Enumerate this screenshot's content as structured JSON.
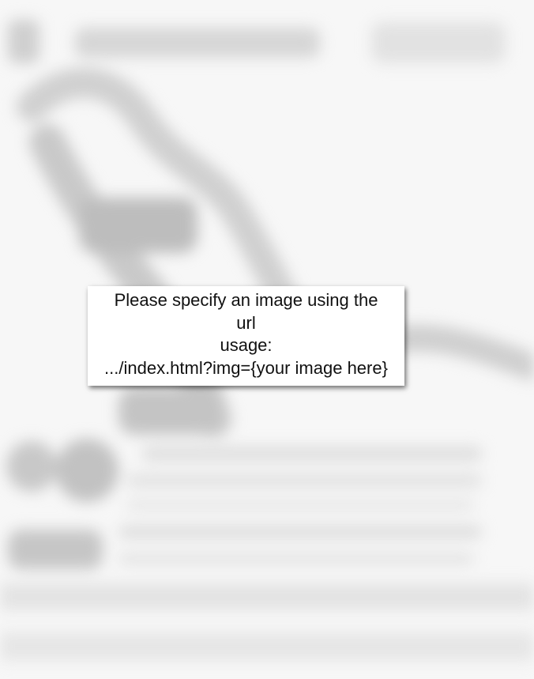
{
  "notice": {
    "line_1": "Please specify an image using the",
    "line_2": "url",
    "line_3": "usage:",
    "line_4": ".../index.html?img={your image here}"
  }
}
